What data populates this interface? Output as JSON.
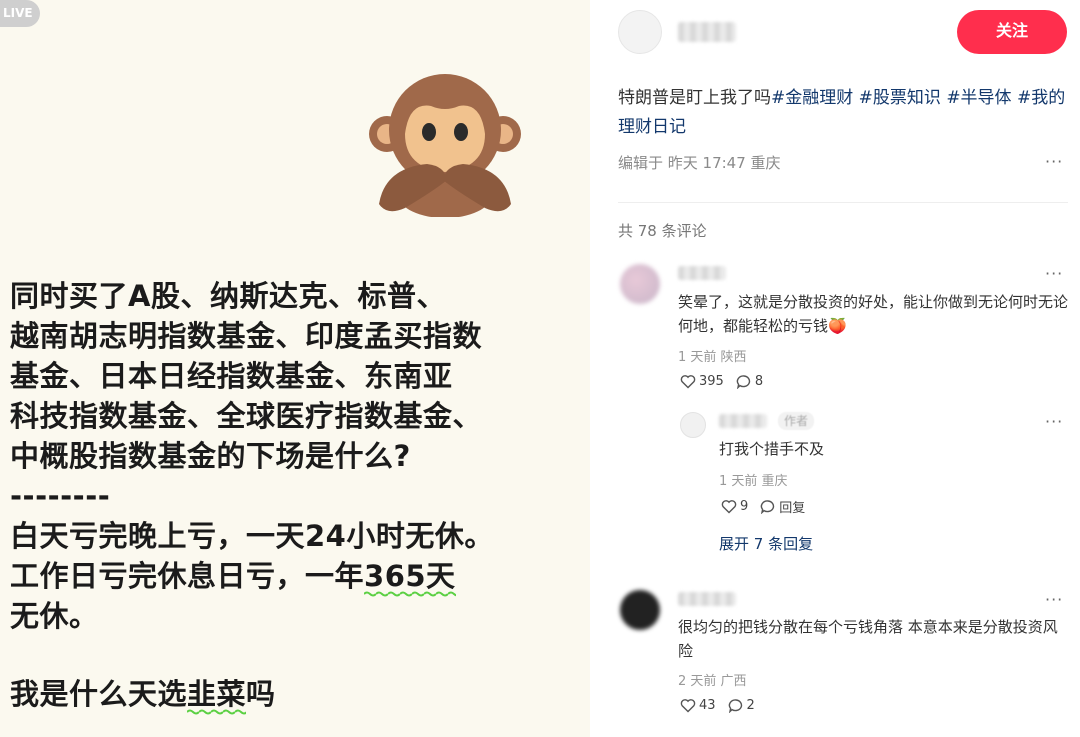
{
  "image_panel": {
    "live_badge": "LIVE",
    "lines": [
      "同时买了A股、纳斯达克、标普、",
      "越南胡志明指数基金、印度孟买指数",
      "基金、日本日经指数基金、东南亚",
      "科技指数基金、全球医疗指数基金、",
      "中概股指数基金的下场是什么?",
      "--------"
    ],
    "line7": "白天亏完晚上亏，一天24小时无休。",
    "line8_pre": "工作日亏完休息日亏，一年",
    "line8_hl": "365天",
    "line9": "无休。",
    "line10_pre": "我是什么天选",
    "line10_hl": "韭菜",
    "line10_post": "吗"
  },
  "post": {
    "follow_label": "关注",
    "title_text": "特朗普是盯上我了吗",
    "tags": [
      "#金融理财",
      "#股票知识",
      "#半导体",
      "#我的理财日记"
    ],
    "edit_meta": "编辑于 昨天 17:47 重庆",
    "more": "···",
    "comment_count": "共 78 条评论"
  },
  "comments": [
    {
      "text": "笑晕了，这就是分散投资的好处，能让你做到无论何时无论何地，都能轻松的亏钱🍑",
      "meta": "1 天前 陕西",
      "likes": "395",
      "replies": "8",
      "more": "···"
    },
    {
      "text": "打我个措手不及",
      "author_badge": "作者",
      "meta": "1 天前 重庆",
      "likes": "9",
      "reply_label": "回复",
      "more": "···"
    },
    {
      "text": "很均匀的把钱分散在每个亏钱角落 本意本来是分散投资风险",
      "meta": "2 天前 广西",
      "likes": "43",
      "replies": "2",
      "more": "···"
    }
  ],
  "expand_label": "展开 7 条回复",
  "colors": {
    "follow": "#ff2e4d",
    "tag": "#13386c",
    "underline": "#5bd043"
  }
}
